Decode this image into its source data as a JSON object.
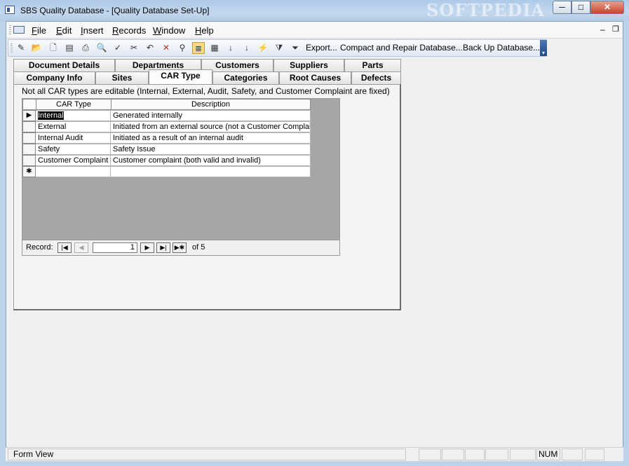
{
  "window": {
    "title": "SBS Quality Database - [Quality Database Set-Up]",
    "watermark": "SOFTPEDIA",
    "controls": {
      "minimize": "─",
      "maximize": "□",
      "close": "✕"
    }
  },
  "menubar": {
    "items": [
      "File",
      "Edit",
      "Insert",
      "Records",
      "Window",
      "Help"
    ],
    "mdi_min": "–",
    "mdi_restore": "❐"
  },
  "toolbar": {
    "icons": [
      "design-view",
      "open",
      "new",
      "properties",
      "print",
      "print-preview",
      "spelling",
      "paste-format",
      "undo",
      "delete",
      "find",
      "form-view",
      "datasheet",
      "sort-ascending",
      "sort-descending",
      "filter-by-selection",
      "filter-by-form",
      "apply-filter"
    ],
    "export_label": "Export...",
    "compact_label": "Compact and Repair Database...",
    "backup_label": "Back Up Database...",
    "more": "▾"
  },
  "tabs": {
    "row1": [
      "Document Details",
      "Departments",
      "Customers",
      "Suppliers",
      "Parts"
    ],
    "row2": [
      "Company Info",
      "Sites",
      "CAR Type",
      "Categories",
      "Root Causes",
      "Defects"
    ],
    "selected": "CAR Type"
  },
  "panel": {
    "note": "Not all CAR types are editable (Internal, External, Audit, Safety, and Customer Complaint are fixed)",
    "columns": [
      "CAR Type",
      "Description"
    ],
    "rows": [
      {
        "type": "Internal",
        "description": "Generated internally"
      },
      {
        "type": "External",
        "description": "Initiated from an  external source (not a Customer Complaint)"
      },
      {
        "type": "Internal Audit",
        "description": "Initiated as a result of an internal audit"
      },
      {
        "type": "Safety",
        "description": "Safety Issue"
      },
      {
        "type": "Customer Complaint",
        "description": "Customer complaint (both valid and invalid)"
      }
    ],
    "current_marker": "▶",
    "new_marker": "✱"
  },
  "navigator": {
    "label": "Record:",
    "current": "1",
    "of_text": "of  5",
    "first": "|◀",
    "prev": "◀",
    "next": "▶",
    "last": "▶|",
    "new": "▶✱"
  },
  "status": {
    "left": "Form View",
    "num": "NUM"
  }
}
